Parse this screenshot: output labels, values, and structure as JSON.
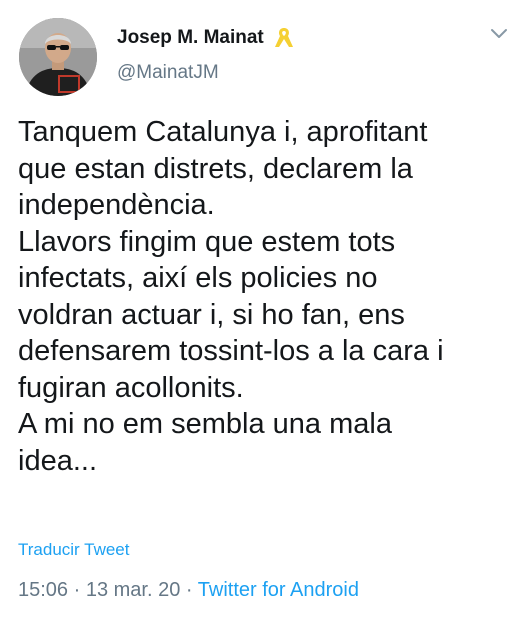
{
  "author": {
    "display_name": "Josep M. Mainat",
    "handle": "@MainatJM",
    "badge_icon": "yellow-ribbon-icon",
    "badge_color": "#f5d033"
  },
  "tweet": {
    "lines": [
      "Tanquem Catalunya i, aprofitant",
      "que estan distrets, declarem la",
      "independència.",
      "Llavors fingim que estem tots",
      "infectats, així els policies no",
      "voldran actuar i, si ho fan, ens",
      "defensarem tossint-los a la cara i",
      "fugiran acollonits.",
      "A mi no em sembla una mala",
      "idea..."
    ],
    "translate_label": "Traducir Tweet",
    "time": "15:06",
    "separator": " · ",
    "date": "13 mar. 20",
    "source": "Twitter for Android"
  },
  "menu": {
    "icon": "chevron-down-icon"
  },
  "colors": {
    "text": "#14171a",
    "secondary": "#657786",
    "link": "#1da1f2"
  }
}
